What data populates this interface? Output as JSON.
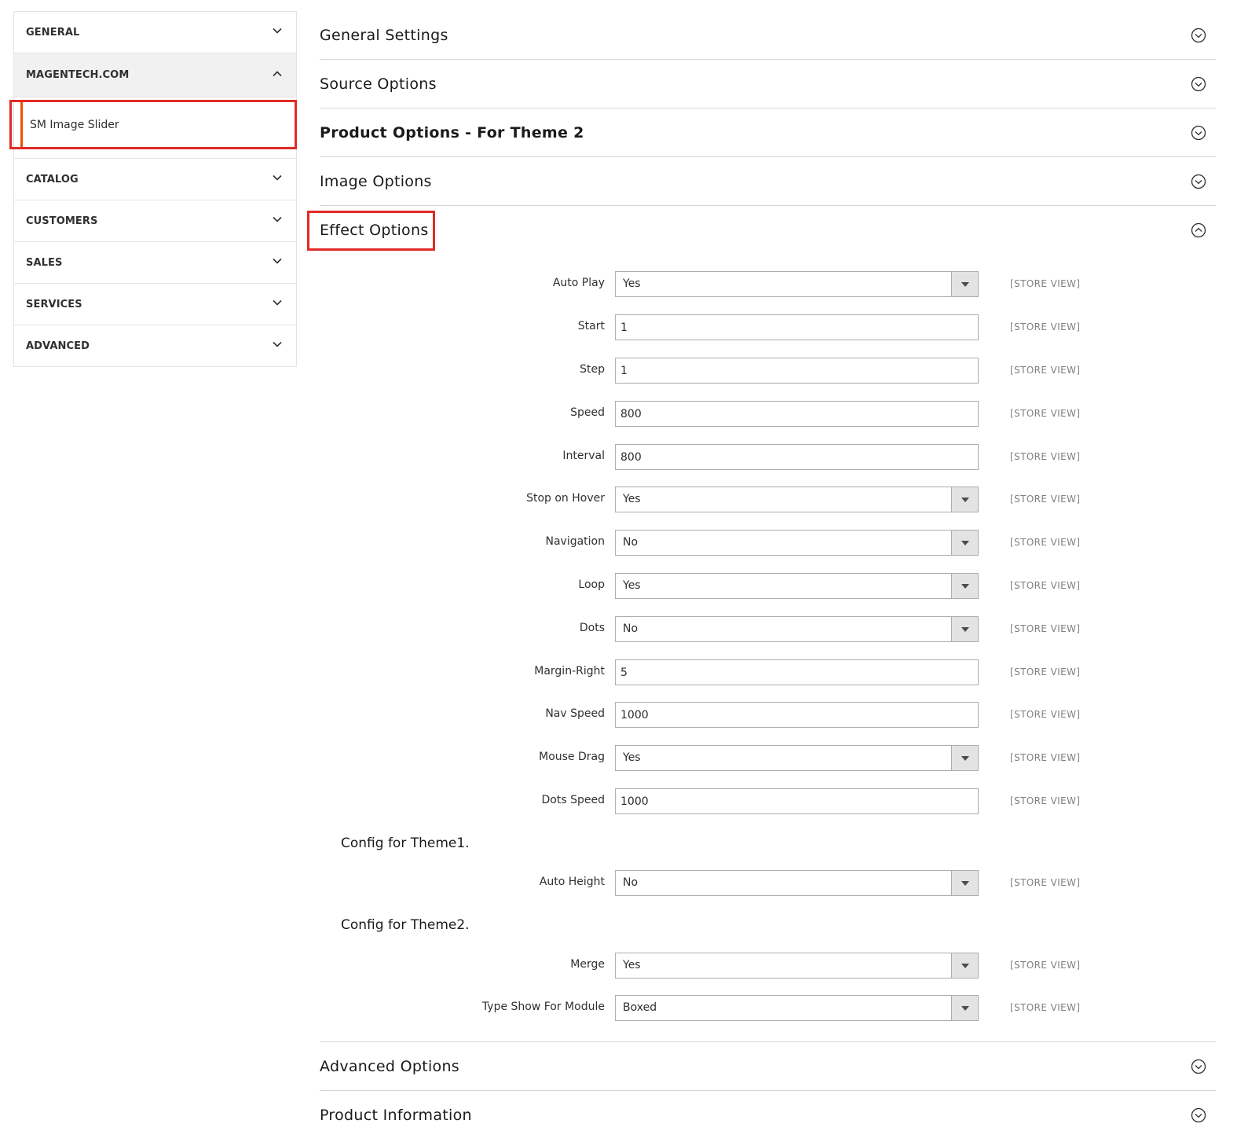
{
  "sidebar": {
    "items": [
      {
        "label": "GENERAL"
      },
      {
        "label": "MAGENTECH.COM"
      },
      {
        "label": "SM Image Slider"
      },
      {
        "label": "CATALOG"
      },
      {
        "label": "CUSTOMERS"
      },
      {
        "label": "SALES"
      },
      {
        "label": "SERVICES"
      },
      {
        "label": "ADVANCED"
      }
    ]
  },
  "sections": {
    "general_settings": "General Settings",
    "source_options": "Source Options",
    "product_options": "Product Options - For Theme 2",
    "image_options": "Image Options",
    "effect_options": "Effect Options",
    "advanced_options": "Advanced Options",
    "product_information": "Product Information"
  },
  "effect": {
    "scope_label": "[STORE VIEW]",
    "fields": [
      {
        "label": "Auto Play",
        "type": "select",
        "value": "Yes"
      },
      {
        "label": "Start",
        "type": "text",
        "value": "1"
      },
      {
        "label": "Step",
        "type": "text",
        "value": "1"
      },
      {
        "label": "Speed",
        "type": "text",
        "value": "800"
      },
      {
        "label": "Interval",
        "type": "text",
        "value": "800"
      },
      {
        "label": "Stop on Hover",
        "type": "select",
        "value": "Yes"
      },
      {
        "label": "Navigation",
        "type": "select",
        "value": "No"
      },
      {
        "label": "Loop",
        "type": "select",
        "value": "Yes"
      },
      {
        "label": "Dots",
        "type": "select",
        "value": "No"
      },
      {
        "label": "Margin-Right",
        "type": "text",
        "value": "5"
      },
      {
        "label": "Nav Speed",
        "type": "text",
        "value": "1000"
      },
      {
        "label": "Mouse Drag",
        "type": "select",
        "value": "Yes"
      },
      {
        "label": "Dots Speed",
        "type": "text",
        "value": "1000"
      }
    ],
    "theme1_heading": "Config for Theme1.",
    "theme1_fields": [
      {
        "label": "Auto Height",
        "type": "select",
        "value": "No"
      }
    ],
    "theme2_heading": "Config for Theme2.",
    "theme2_fields": [
      {
        "label": "Merge",
        "type": "select",
        "value": "Yes"
      },
      {
        "label": "Type Show For Module",
        "type": "select",
        "value": "Boxed"
      }
    ]
  },
  "colors": {
    "highlight": "#e02b27",
    "active_bar": "#eb5202",
    "border": "#adadad"
  }
}
